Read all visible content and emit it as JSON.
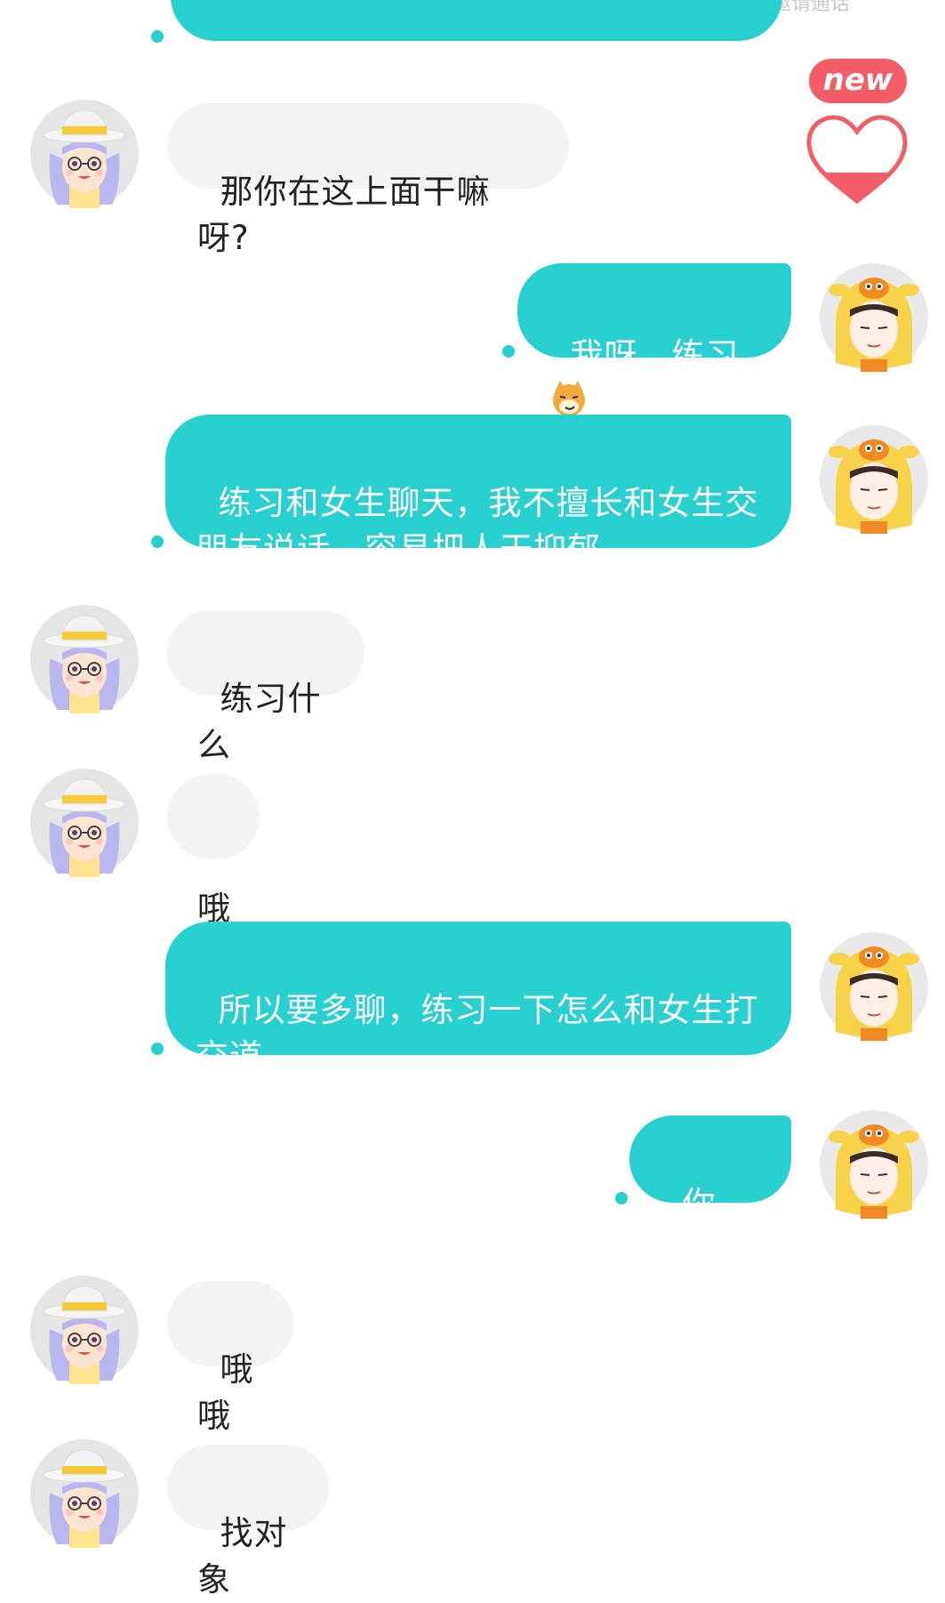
{
  "header": {
    "hint": "关注后可邀请通话"
  },
  "widget": {
    "badge_label": "new"
  },
  "colors": {
    "accent": "#28d0cf",
    "incoming_bg": "#f4f4f4",
    "badge": "#f35d67",
    "heart": "#f35d67"
  },
  "messages": [
    {
      "side": "in",
      "text": "那你在这上面干嘛呀?"
    },
    {
      "side": "out",
      "text": "我呀，练习",
      "emoji": "smirking-dog-emoji"
    },
    {
      "side": "out",
      "text": "练习和女生聊天，我不擅长和女生交朋友说话，容易把人干抑郁"
    },
    {
      "side": "in",
      "text": "练习什么"
    },
    {
      "side": "in",
      "text": "哦"
    },
    {
      "side": "out",
      "text": "所以要多聊，练习一下怎么和女生打交道"
    },
    {
      "side": "out",
      "text": "你呢?"
    },
    {
      "side": "in",
      "text": "哦哦"
    },
    {
      "side": "in",
      "text": "找对象"
    }
  ]
}
